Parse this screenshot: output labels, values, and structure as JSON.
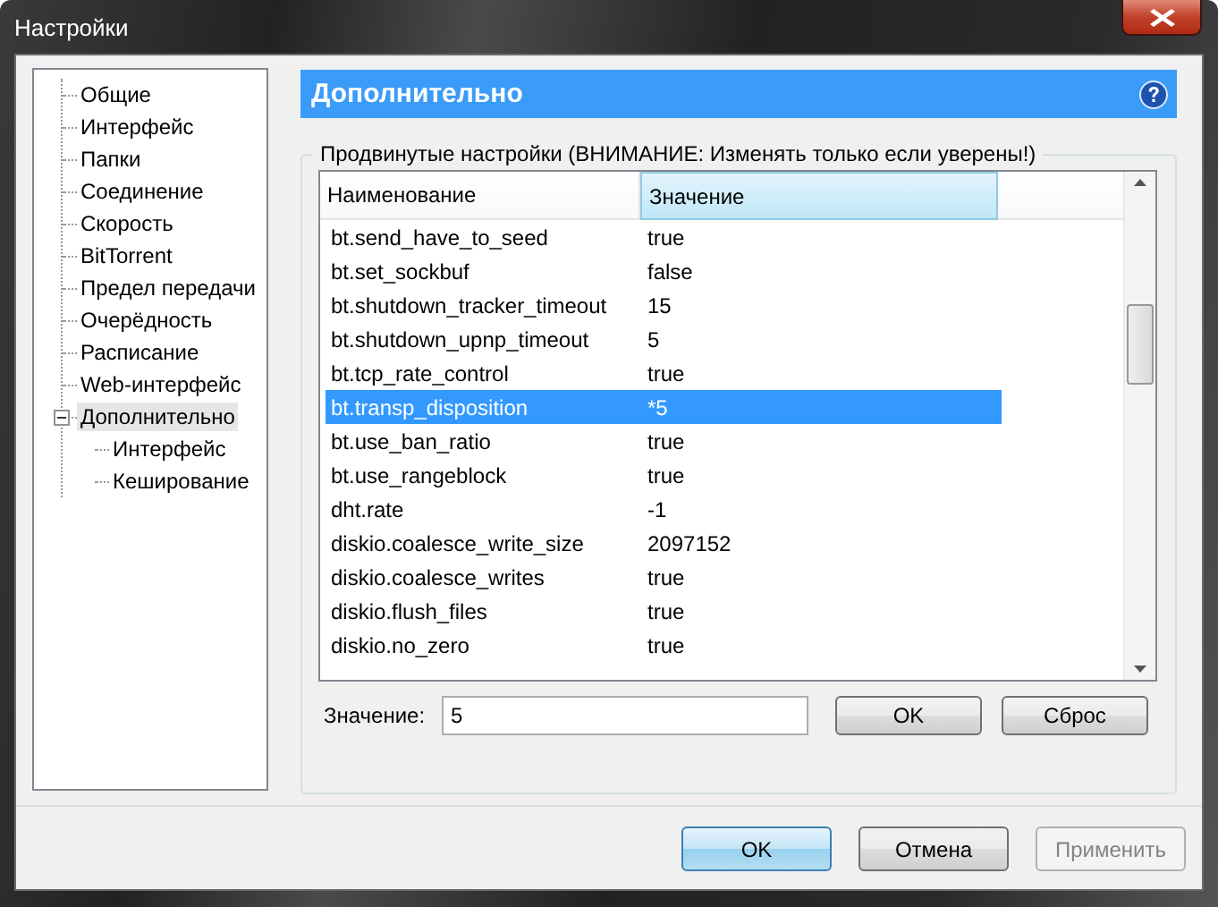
{
  "window": {
    "title": "Настройки"
  },
  "sidebar": {
    "items": [
      {
        "label": "Общие",
        "selected": false
      },
      {
        "label": "Интерфейс",
        "selected": false
      },
      {
        "label": "Папки",
        "selected": false
      },
      {
        "label": "Соединение",
        "selected": false
      },
      {
        "label": "Скорость",
        "selected": false
      },
      {
        "label": "BitTorrent",
        "selected": false
      },
      {
        "label": "Предел передачи",
        "selected": false
      },
      {
        "label": "Очерёдность",
        "selected": false
      },
      {
        "label": "Расписание",
        "selected": false
      },
      {
        "label": "Web-интерфейс",
        "selected": false
      },
      {
        "label": "Дополнительно",
        "selected": true,
        "expanded": true,
        "children": [
          {
            "label": "Интерфейс",
            "selected": false
          },
          {
            "label": "Кеширование",
            "selected": false
          }
        ]
      }
    ]
  },
  "panel": {
    "title": "Дополнительно",
    "group_title": "Продвинутые настройки (ВНИМАНИЕ: Изменять только если уверены!)"
  },
  "table": {
    "columns": [
      {
        "label": "Наименование",
        "highlighted": false
      },
      {
        "label": "Значение",
        "highlighted": true
      }
    ],
    "rows": [
      {
        "name": "bt.send_have_to_seed",
        "value": "true",
        "selected": false
      },
      {
        "name": "bt.set_sockbuf",
        "value": "false",
        "selected": false
      },
      {
        "name": "bt.shutdown_tracker_timeout",
        "value": "15",
        "selected": false
      },
      {
        "name": "bt.shutdown_upnp_timeout",
        "value": "5",
        "selected": false
      },
      {
        "name": "bt.tcp_rate_control",
        "value": "true",
        "selected": false
      },
      {
        "name": "bt.transp_disposition",
        "value": "*5",
        "selected": true
      },
      {
        "name": "bt.use_ban_ratio",
        "value": "true",
        "selected": false
      },
      {
        "name": "bt.use_rangeblock",
        "value": "true",
        "selected": false
      },
      {
        "name": "dht.rate",
        "value": "-1",
        "selected": false
      },
      {
        "name": "diskio.coalesce_write_size",
        "value": "2097152",
        "selected": false
      },
      {
        "name": "diskio.coalesce_writes",
        "value": "true",
        "selected": false
      },
      {
        "name": "diskio.flush_files",
        "value": "true",
        "selected": false
      },
      {
        "name": "diskio.no_zero",
        "value": "true",
        "selected": false
      }
    ]
  },
  "value_field": {
    "label": "Значение:",
    "value": "5"
  },
  "value_buttons": [
    "OK",
    "Сброс"
  ],
  "buttons": [
    {
      "label": "OK",
      "default": true,
      "disabled": false
    },
    {
      "label": "Отмена",
      "default": false,
      "disabled": false
    },
    {
      "label": "Применить",
      "default": false,
      "disabled": true
    }
  ]
}
